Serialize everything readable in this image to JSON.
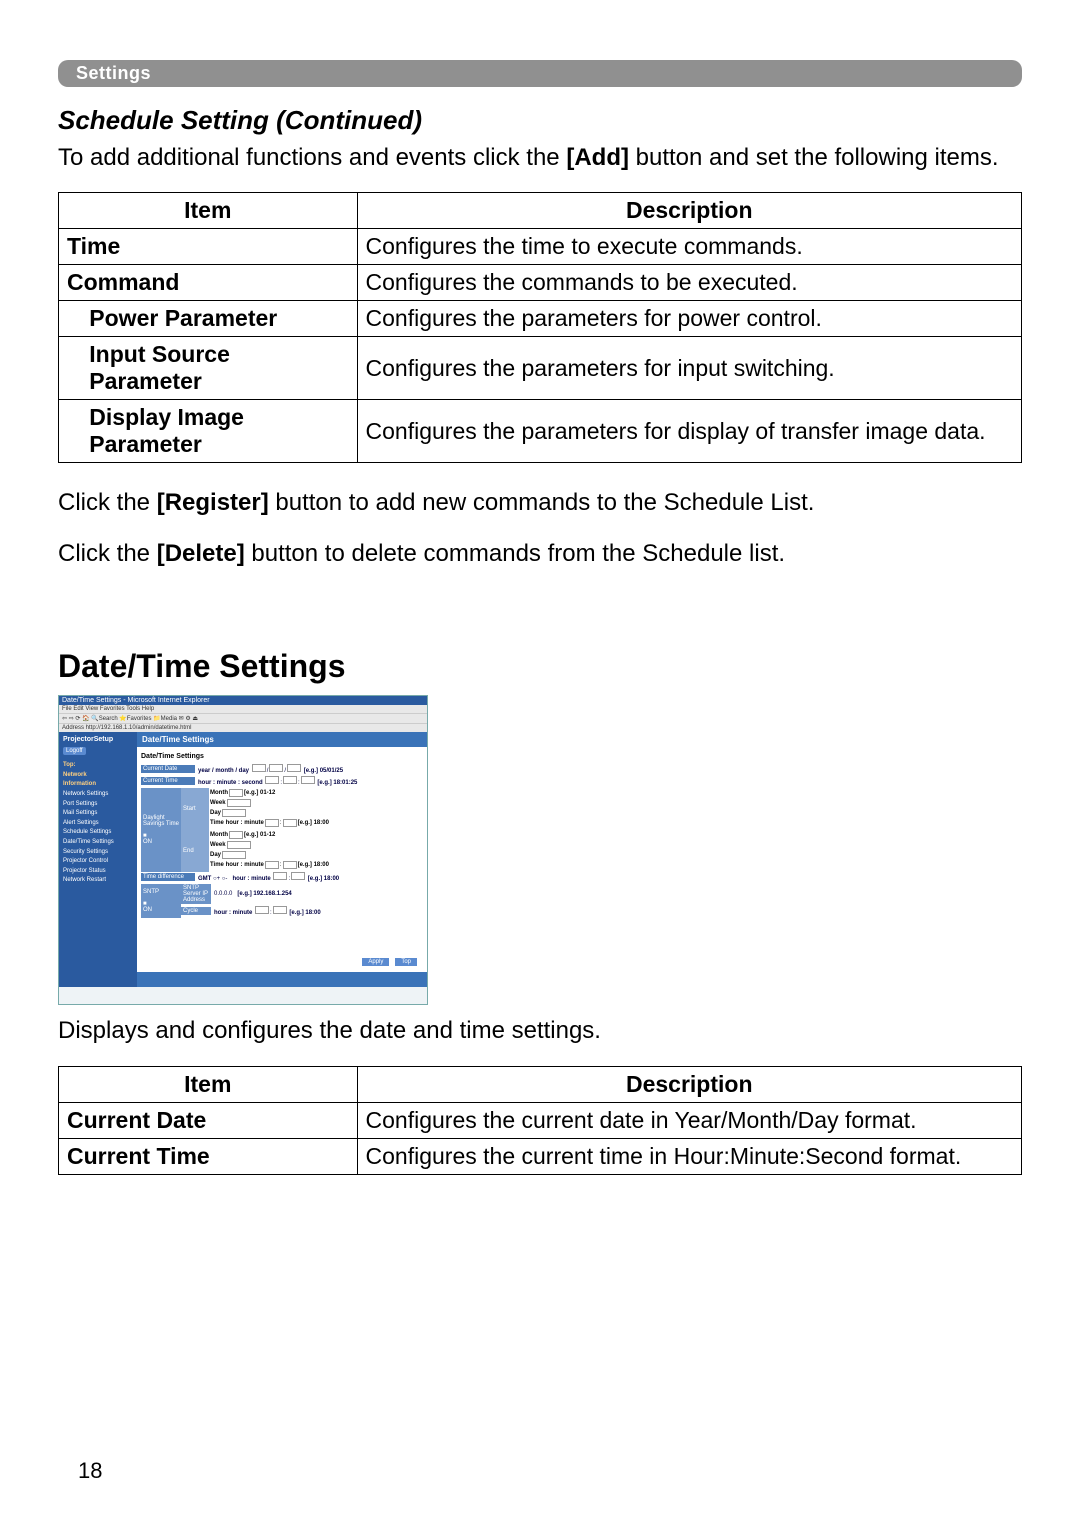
{
  "header": "Settings",
  "subtitle": "Schedule Setting (Continued)",
  "intro": "To add additional functions and events click the [Add] button and set the following items.",
  "table1": {
    "headers": [
      "Item",
      "Description"
    ],
    "rows": [
      {
        "item": "Time",
        "desc": "Configures the time to execute commands."
      },
      {
        "item": "Command",
        "desc": "Configures the commands to be executed."
      },
      {
        "item": "Power Parameter",
        "desc": "Configures the parameters for power control.",
        "indent": true
      },
      {
        "item": "Input Source Parameter",
        "desc": "Configures the parameters for input switching.",
        "indent": true
      },
      {
        "item": "Display Image Parameter",
        "desc": "Configures the parameters for display of transfer image data.",
        "indent": true
      }
    ]
  },
  "note1": "Click the [Register] button to add new commands to the Schedule List.",
  "note2": "Click the [Delete] button to delete commands from the Schedule list.",
  "bigtitle": "Date/Time Settings",
  "screenshot": {
    "title": "Date/Time Settings - Microsoft Internet Explorer",
    "menu": "File  Edit  View  Favorites  Tools  Help",
    "addr": "Address  http://192.168.1.10/admin/datetime.html",
    "brand": "ProjectorSetup",
    "logoff": "Logoff",
    "nav": [
      "Top:",
      "Network",
      "Information",
      "Network Settings",
      "Port Settings",
      "Mail Settings",
      "Alert Settings",
      "Schedule Settings",
      "Date/Time Settings",
      "Security Settings",
      "Projector Control",
      "Projector Status",
      "Network Restart"
    ],
    "mainTitle": "Date/Time Settings",
    "subTitle": "Date/Time Settings",
    "currentDate": {
      "label": "Current Date",
      "val": "year / month / day",
      "eg": "[e.g.] 05/01/25"
    },
    "currentTime": {
      "label": "Current Time",
      "val": "hour : minute : second",
      "eg": "[e.g.] 18:01:25"
    },
    "daylight": {
      "label": "Daylight Savings Time",
      "on": "ON",
      "start": {
        "label": "Start",
        "month": "Month",
        "monthEg": "[e.g.] 01-12",
        "week": "Week",
        "day": "Day",
        "time": "Time  hour : minute",
        "timeEg": "[e.g.] 18:00"
      },
      "end": {
        "label": "End",
        "month": "Month",
        "monthEg": "[e.g.] 01-12",
        "week": "Week",
        "day": "Day",
        "time": "Time  hour : minute",
        "timeEg": "[e.g.] 18:00"
      }
    },
    "timediff": {
      "label": "Time difference",
      "val": "GMT",
      "hm": "hour : minute",
      "eg": "[e.g.] 18:00"
    },
    "sntp": {
      "label": "SNTP",
      "on": "ON",
      "serverLabel": "SNTP Server IP Address",
      "server": "0.0.0.0",
      "serverEg": "[e.g.] 192.168.1.254",
      "cycleLabel": "Cycle",
      "cycle": "hour : minute",
      "cycleEg": "[e.g.] 18:00"
    },
    "apply": "Apply",
    "top": "Top"
  },
  "postImage": "Displays and configures the date and time settings.",
  "table2": {
    "headers": [
      "Item",
      "Description"
    ],
    "rows": [
      {
        "item": "Current Date",
        "desc": "Configures the current date in Year/Month/Day format."
      },
      {
        "item": "Current Time",
        "desc": "Configures the current time in Hour:Minute:Second format."
      }
    ]
  },
  "pageNum": "18"
}
